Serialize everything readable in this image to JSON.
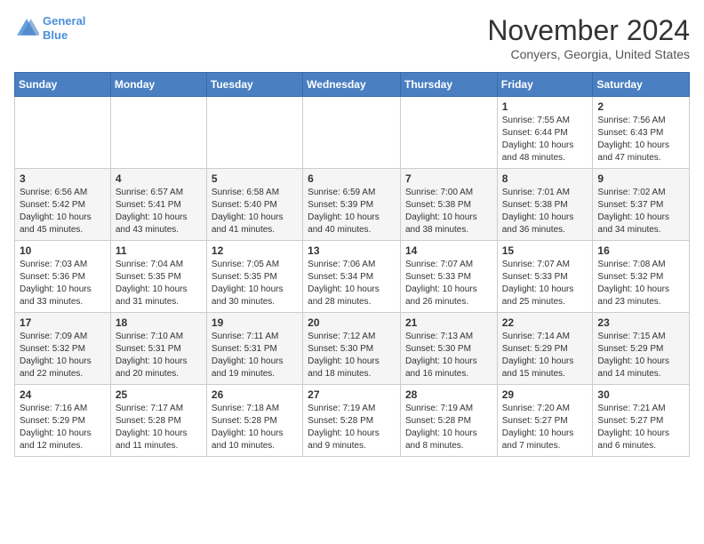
{
  "logo": {
    "line1": "General",
    "line2": "Blue"
  },
  "title": "November 2024",
  "location": "Conyers, Georgia, United States",
  "weekdays": [
    "Sunday",
    "Monday",
    "Tuesday",
    "Wednesday",
    "Thursday",
    "Friday",
    "Saturday"
  ],
  "weeks": [
    [
      {
        "day": "",
        "info": ""
      },
      {
        "day": "",
        "info": ""
      },
      {
        "day": "",
        "info": ""
      },
      {
        "day": "",
        "info": ""
      },
      {
        "day": "",
        "info": ""
      },
      {
        "day": "1",
        "info": "Sunrise: 7:55 AM\nSunset: 6:44 PM\nDaylight: 10 hours and 48 minutes."
      },
      {
        "day": "2",
        "info": "Sunrise: 7:56 AM\nSunset: 6:43 PM\nDaylight: 10 hours and 47 minutes."
      }
    ],
    [
      {
        "day": "3",
        "info": "Sunrise: 6:56 AM\nSunset: 5:42 PM\nDaylight: 10 hours and 45 minutes."
      },
      {
        "day": "4",
        "info": "Sunrise: 6:57 AM\nSunset: 5:41 PM\nDaylight: 10 hours and 43 minutes."
      },
      {
        "day": "5",
        "info": "Sunrise: 6:58 AM\nSunset: 5:40 PM\nDaylight: 10 hours and 41 minutes."
      },
      {
        "day": "6",
        "info": "Sunrise: 6:59 AM\nSunset: 5:39 PM\nDaylight: 10 hours and 40 minutes."
      },
      {
        "day": "7",
        "info": "Sunrise: 7:00 AM\nSunset: 5:38 PM\nDaylight: 10 hours and 38 minutes."
      },
      {
        "day": "8",
        "info": "Sunrise: 7:01 AM\nSunset: 5:38 PM\nDaylight: 10 hours and 36 minutes."
      },
      {
        "day": "9",
        "info": "Sunrise: 7:02 AM\nSunset: 5:37 PM\nDaylight: 10 hours and 34 minutes."
      }
    ],
    [
      {
        "day": "10",
        "info": "Sunrise: 7:03 AM\nSunset: 5:36 PM\nDaylight: 10 hours and 33 minutes."
      },
      {
        "day": "11",
        "info": "Sunrise: 7:04 AM\nSunset: 5:35 PM\nDaylight: 10 hours and 31 minutes."
      },
      {
        "day": "12",
        "info": "Sunrise: 7:05 AM\nSunset: 5:35 PM\nDaylight: 10 hours and 30 minutes."
      },
      {
        "day": "13",
        "info": "Sunrise: 7:06 AM\nSunset: 5:34 PM\nDaylight: 10 hours and 28 minutes."
      },
      {
        "day": "14",
        "info": "Sunrise: 7:07 AM\nSunset: 5:33 PM\nDaylight: 10 hours and 26 minutes."
      },
      {
        "day": "15",
        "info": "Sunrise: 7:07 AM\nSunset: 5:33 PM\nDaylight: 10 hours and 25 minutes."
      },
      {
        "day": "16",
        "info": "Sunrise: 7:08 AM\nSunset: 5:32 PM\nDaylight: 10 hours and 23 minutes."
      }
    ],
    [
      {
        "day": "17",
        "info": "Sunrise: 7:09 AM\nSunset: 5:32 PM\nDaylight: 10 hours and 22 minutes."
      },
      {
        "day": "18",
        "info": "Sunrise: 7:10 AM\nSunset: 5:31 PM\nDaylight: 10 hours and 20 minutes."
      },
      {
        "day": "19",
        "info": "Sunrise: 7:11 AM\nSunset: 5:31 PM\nDaylight: 10 hours and 19 minutes."
      },
      {
        "day": "20",
        "info": "Sunrise: 7:12 AM\nSunset: 5:30 PM\nDaylight: 10 hours and 18 minutes."
      },
      {
        "day": "21",
        "info": "Sunrise: 7:13 AM\nSunset: 5:30 PM\nDaylight: 10 hours and 16 minutes."
      },
      {
        "day": "22",
        "info": "Sunrise: 7:14 AM\nSunset: 5:29 PM\nDaylight: 10 hours and 15 minutes."
      },
      {
        "day": "23",
        "info": "Sunrise: 7:15 AM\nSunset: 5:29 PM\nDaylight: 10 hours and 14 minutes."
      }
    ],
    [
      {
        "day": "24",
        "info": "Sunrise: 7:16 AM\nSunset: 5:29 PM\nDaylight: 10 hours and 12 minutes."
      },
      {
        "day": "25",
        "info": "Sunrise: 7:17 AM\nSunset: 5:28 PM\nDaylight: 10 hours and 11 minutes."
      },
      {
        "day": "26",
        "info": "Sunrise: 7:18 AM\nSunset: 5:28 PM\nDaylight: 10 hours and 10 minutes."
      },
      {
        "day": "27",
        "info": "Sunrise: 7:19 AM\nSunset: 5:28 PM\nDaylight: 10 hours and 9 minutes."
      },
      {
        "day": "28",
        "info": "Sunrise: 7:19 AM\nSunset: 5:28 PM\nDaylight: 10 hours and 8 minutes."
      },
      {
        "day": "29",
        "info": "Sunrise: 7:20 AM\nSunset: 5:27 PM\nDaylight: 10 hours and 7 minutes."
      },
      {
        "day": "30",
        "info": "Sunrise: 7:21 AM\nSunset: 5:27 PM\nDaylight: 10 hours and 6 minutes."
      }
    ]
  ]
}
